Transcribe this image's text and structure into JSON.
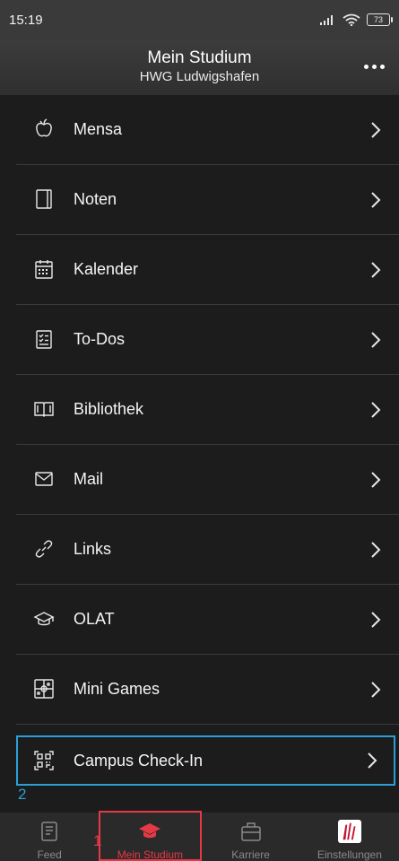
{
  "status_bar": {
    "time": "15:19",
    "battery": "73"
  },
  "header": {
    "title": "Mein Studium",
    "subtitle": "HWG Ludwigshafen"
  },
  "menu": {
    "items": [
      {
        "label": "Mensa",
        "icon": "apple-icon"
      },
      {
        "label": "Noten",
        "icon": "notebook-icon"
      },
      {
        "label": "Kalender",
        "icon": "calendar-icon"
      },
      {
        "label": "To-Dos",
        "icon": "checklist-icon"
      },
      {
        "label": "Bibliothek",
        "icon": "book-icon"
      },
      {
        "label": "Mail",
        "icon": "mail-icon"
      },
      {
        "label": "Links",
        "icon": "link-icon"
      },
      {
        "label": "OLAT",
        "icon": "graduation-cap-icon"
      },
      {
        "label": "Mini Games",
        "icon": "game-grid-icon"
      },
      {
        "label": "Campus Check-In",
        "icon": "qr-code-icon"
      }
    ]
  },
  "annotations": {
    "one": "1",
    "two": "2"
  },
  "bottom_nav": {
    "items": [
      {
        "label": "Feed",
        "icon": "feed-icon"
      },
      {
        "label": "Mein Studium",
        "icon": "graduation-cap-icon"
      },
      {
        "label": "Karriere",
        "icon": "briefcase-icon"
      },
      {
        "label": "Einstellungen",
        "icon": "logo-icon"
      }
    ]
  },
  "colors": {
    "background": "#1c1c1c",
    "highlight_blue": "#2b9fd6",
    "active_red": "#e63946",
    "inactive_gray": "#8a8a8a"
  }
}
